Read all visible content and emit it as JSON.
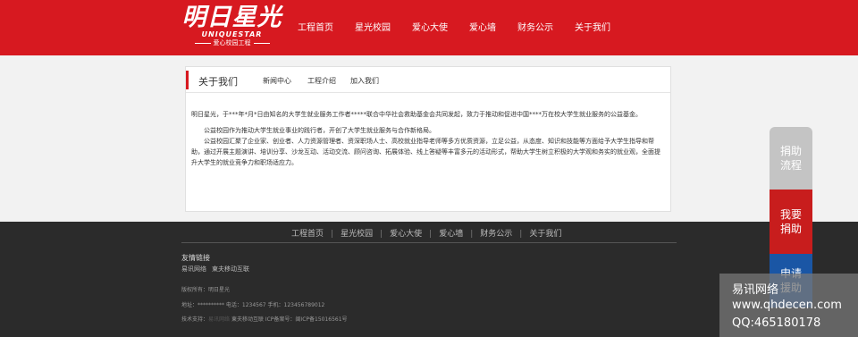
{
  "header": {
    "logo": {
      "main": "明日星光",
      "sub": "UNIQUESTAR",
      "tag": "爱心校园工程"
    },
    "nav": [
      "工程首页",
      "星光校园",
      "爱心大使",
      "爱心墙",
      "财务公示",
      "关于我们"
    ]
  },
  "panel": {
    "title": "关于我们",
    "tabs": [
      "新闻中心",
      "工程介绍",
      "加入我们"
    ],
    "paragraphs": [
      "明日星光，于***年*月*日由知名的大学生就业服务工作者*****联合中华社会救助基金会共同发起，致力于推动和促进中国****万在校大学生就业服务的公益基金。",
      "公益校园作为推动大学生就业事业的践行者，开创了大学生就业服务与合作新格局。",
      "公益校园汇聚了企业家、创业者、人力资源管理者、资深职场人士、高校就业指导老师等多方优质资源，立足公益，从态度、知识和技能等方面给予大学生指导和帮助，通过开展主题演讲、培训分享、沙龙互动、活动交流、顾问咨询、拓展体验、线上答疑等丰富多元的活动形式，帮助大学生树立积极的大学观和务实的就业观，全面提升大学生的就业竞争力和职场适应力。"
    ]
  },
  "footer": {
    "nav": [
      "工程首页",
      "星光校园",
      "爱心大使",
      "爱心墙",
      "财务公示",
      "关于我们"
    ],
    "separator": "|",
    "links_title": "友情链接",
    "links": [
      "易讯网络",
      "東夫移动互联"
    ],
    "copyright": "版权所有：明日星光",
    "address": "地址：**********   电话：1234567   手机：123456789012",
    "tech_prefix": "技术支持：",
    "tech_dim": "易讯网络",
    "tech_rest": "   東夫移动互联    ICP备案号：闽ICP备15016561号"
  },
  "float": {
    "help": [
      "捐助",
      "流程"
    ],
    "donate": [
      "我要",
      "捐助"
    ],
    "apply": [
      "申请",
      "援助"
    ]
  },
  "watermark": [
    "易讯网络",
    "www.qhdecen.com",
    "QQ:465180178"
  ],
  "colors": {
    "brand_red": "#d71920",
    "footer_bg": "#2b2b2b",
    "apply_blue": "#1a56a5"
  }
}
